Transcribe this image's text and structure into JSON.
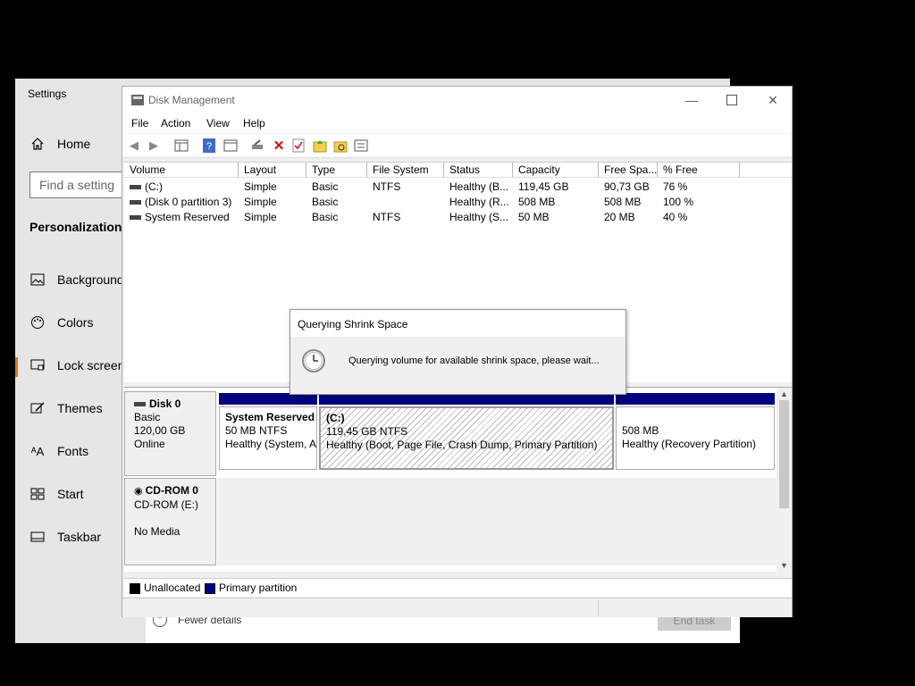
{
  "settings": {
    "title": "Settings",
    "home": "Home",
    "search_placeholder": "Find a setting",
    "section": "Personalization",
    "items": [
      {
        "label": "Background",
        "icon": "image-icon"
      },
      {
        "label": "Colors",
        "icon": "palette-icon"
      },
      {
        "label": "Lock screen",
        "icon": "lock-screen-icon"
      },
      {
        "label": "Themes",
        "icon": "brush-icon"
      },
      {
        "label": "Fonts",
        "icon": "font-icon"
      },
      {
        "label": "Start",
        "icon": "start-icon"
      },
      {
        "label": "Taskbar",
        "icon": "taskbar-icon"
      }
    ],
    "accent": "#e0761a"
  },
  "taskmgr": {
    "fewer_details": "Fewer details",
    "end_task": "End task"
  },
  "diskmgmt": {
    "title": "Disk Management",
    "menu": [
      "File",
      "Action",
      "View",
      "Help"
    ],
    "columns": [
      "Volume",
      "Layout",
      "Type",
      "File System",
      "Status",
      "Capacity",
      "Free Spa...",
      "% Free"
    ],
    "rows": [
      [
        "(C:)",
        "Simple",
        "Basic",
        "NTFS",
        "Healthy (B...",
        "119,45 GB",
        "90,73 GB",
        "76 %"
      ],
      [
        "(Disk 0 partition 3)",
        "Simple",
        "Basic",
        "",
        "Healthy (R...",
        "508 MB",
        "508 MB",
        "100 %"
      ],
      [
        "System Reserved",
        "Simple",
        "Basic",
        "NTFS",
        "Healthy (S...",
        "50 MB",
        "20 MB",
        "40 %"
      ]
    ],
    "disk0": {
      "name": "Disk 0",
      "type": "Basic",
      "size": "120,00 GB",
      "status": "Online",
      "partitions": [
        {
          "title": "System Reserved",
          "line2": "50 MB NTFS",
          "line3": "Healthy (System, A"
        },
        {
          "title": "(C:)",
          "line2": "119,45 GB NTFS",
          "line3": "Healthy (Boot, Page File, Crash Dump, Primary Partition)"
        },
        {
          "title": "",
          "line2": "508 MB",
          "line3": "Healthy (Recovery Partition)"
        }
      ]
    },
    "cdrom": {
      "name": "CD-ROM 0",
      "drive": "CD-ROM (E:)",
      "media": "No Media"
    },
    "legend": {
      "unallocated": "Unallocated",
      "primary": "Primary partition"
    },
    "colors": {
      "primary": "#00007e",
      "unallocated": "#000000"
    }
  },
  "dialog": {
    "title": "Querying Shrink Space",
    "message": "Querying volume for available shrink space, please wait..."
  }
}
